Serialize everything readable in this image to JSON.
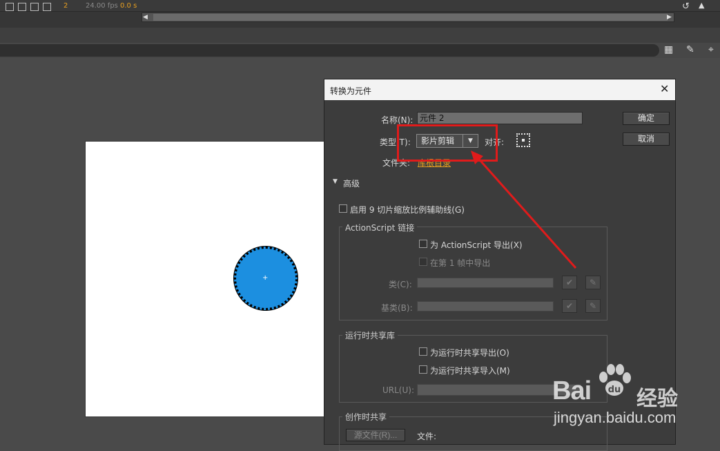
{
  "timeline": {
    "frame": "2",
    "fps": "24.00 fps",
    "time": "0.0 s"
  },
  "dialog": {
    "title": "转换为元件",
    "name_label": "名称(N):",
    "name_value": "元件 2",
    "type_label": "类型(T):",
    "type_value": "影片剪辑",
    "align_label": "对齐:",
    "folder_label": "文件夹:",
    "folder_value": "库根目录",
    "ok_label": "确定",
    "cancel_label": "取消",
    "advanced_label": "高级",
    "nine_slice_label": "启用 9 切片缩放比例辅助线(G)",
    "actionscript_group": "ActionScript 链接",
    "export_as_label": "为 ActionScript 导出(X)",
    "export_frame1_label": "在第 1 帧中导出",
    "class_label": "类(C):",
    "base_class_label": "基类(B):",
    "runtime_group": "运行时共享库",
    "runtime_export_label": "为运行时共享导出(O)",
    "runtime_import_label": "为运行时共享导入(M)",
    "url_label": "URL(U):",
    "authortime_group": "创作时共享",
    "source_file_label": "源文件(R)...",
    "file_label": "文件:"
  },
  "watermark": {
    "logo": "Bai",
    "logo_suffix": "du",
    "cn": "经验",
    "url": "jingyan.baidu.com"
  },
  "colors": {
    "annotation": "#e01b1b",
    "circle_fill": "#1c8fe0",
    "folder_link": "#e8a020",
    "frame_number": "#e8a020"
  }
}
